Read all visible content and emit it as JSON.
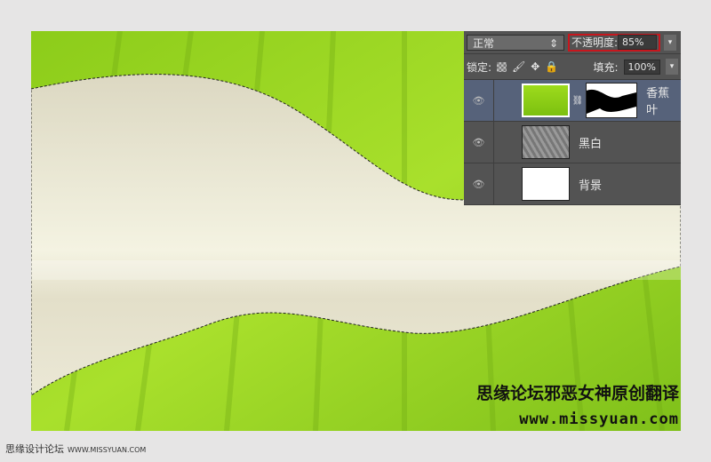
{
  "layers_panel": {
    "blend_mode": "正常",
    "opacity_label": "不透明度:",
    "opacity_value": "85%",
    "lock_label": "锁定:",
    "fill_label": "填充:",
    "fill_value": "100%",
    "layers": [
      {
        "name": "香蕉叶",
        "selected": true
      },
      {
        "name": "黑白",
        "selected": false
      },
      {
        "name": "背景",
        "selected": false
      }
    ]
  },
  "watermark": {
    "title": "思缘论坛邪恶女神原创翻译",
    "url": "www.missyuan.com"
  },
  "footer": {
    "site": "思缘设计论坛",
    "url": "WWW.MISSYUAN.COM"
  },
  "colors": {
    "leaf": "#8fd21c",
    "cream": "#ebe8d6",
    "panel": "#535353",
    "highlight": "#c8161d"
  }
}
